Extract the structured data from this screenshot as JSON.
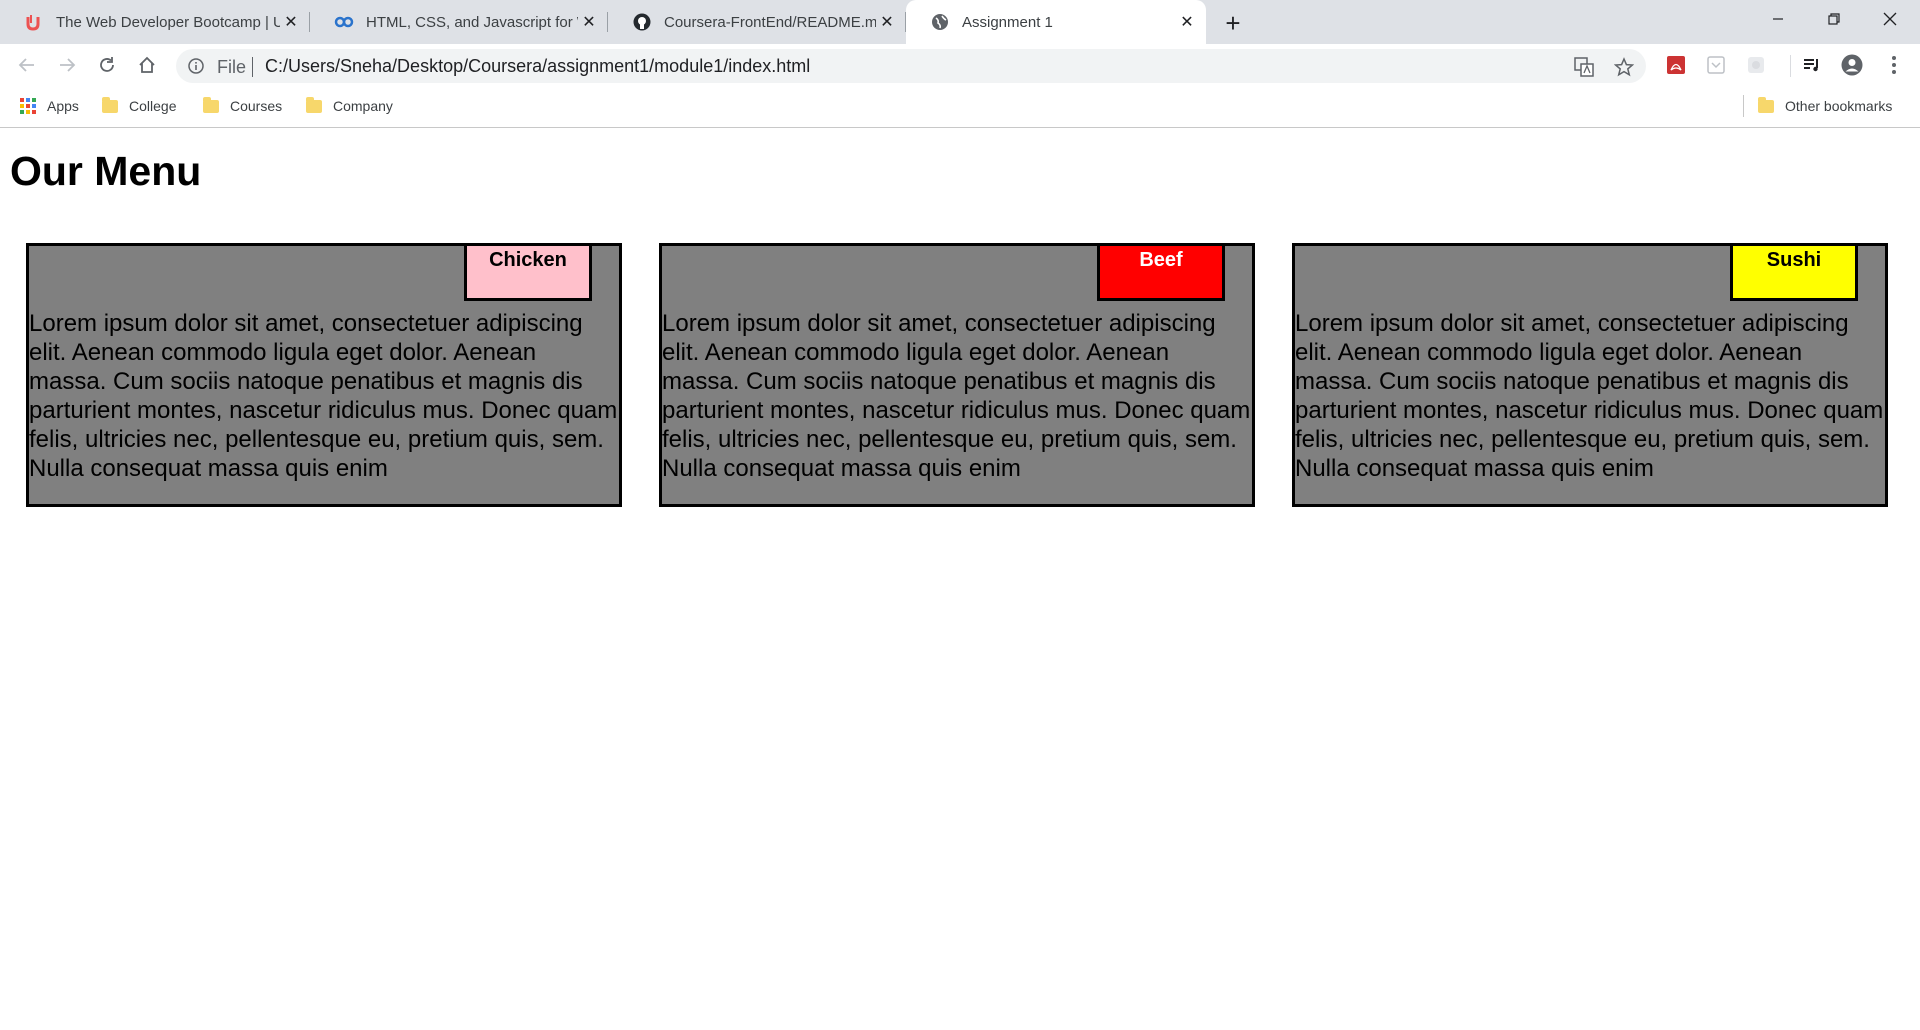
{
  "browser": {
    "tabs": [
      {
        "title": "The Web Developer Bootcamp | Udemy",
        "icon": "udemy-icon"
      },
      {
        "title": "HTML, CSS, and Javascript for Web Developers",
        "icon": "coursera-icon"
      },
      {
        "title": "Coursera-FrontEnd/README.md",
        "icon": "github-icon"
      },
      {
        "title": "Assignment 1",
        "icon": "globe-icon"
      }
    ],
    "address": {
      "scheme": "File",
      "url": "C:/Users/Sneha/Desktop/Coursera/assignment1/module1/index.html"
    },
    "bookmarks": [
      {
        "label": "Apps",
        "icon": "apps-grid-icon"
      },
      {
        "label": "College",
        "icon": "folder-icon"
      },
      {
        "label": "Courses",
        "icon": "folder-icon"
      },
      {
        "label": "Company",
        "icon": "folder-icon"
      }
    ],
    "other_bookmarks": "Other bookmarks"
  },
  "page": {
    "title": "Our Menu",
    "cards": [
      {
        "label": "Chicken",
        "label_bg": "#ffc0cb",
        "label_color": "#000000",
        "text": "Lorem ipsum dolor sit amet, consectetuer adipiscing elit. Aenean commodo ligula eget dolor. Aenean massa. Cum sociis natoque penatibus et magnis dis parturient montes, nascetur ridiculus mus. Donec quam felis, ultricies nec, pellentesque eu, pretium quis, sem. Nulla consequat massa quis enim"
      },
      {
        "label": "Beef",
        "label_bg": "#ff0000",
        "label_color": "#ffffff",
        "text": "Lorem ipsum dolor sit amet, consectetuer adipiscing elit. Aenean commodo ligula eget dolor. Aenean massa. Cum sociis natoque penatibus et magnis dis parturient montes, nascetur ridiculus mus. Donec quam felis, ultricies nec, pellentesque eu, pretium quis, sem. Nulla consequat massa quis enim"
      },
      {
        "label": "Sushi",
        "label_bg": "#ffff00",
        "label_color": "#000000",
        "text": "Lorem ipsum dolor sit amet, consectetuer adipiscing elit. Aenean commodo ligula eget dolor. Aenean massa. Cum sociis natoque penatibus et magnis dis parturient montes, nascetur ridiculus mus. Donec quam felis, ultricies nec, pellentesque eu, pretium quis, sem. Nulla consequat massa quis enim"
      }
    ],
    "card_bg": "#808080"
  }
}
